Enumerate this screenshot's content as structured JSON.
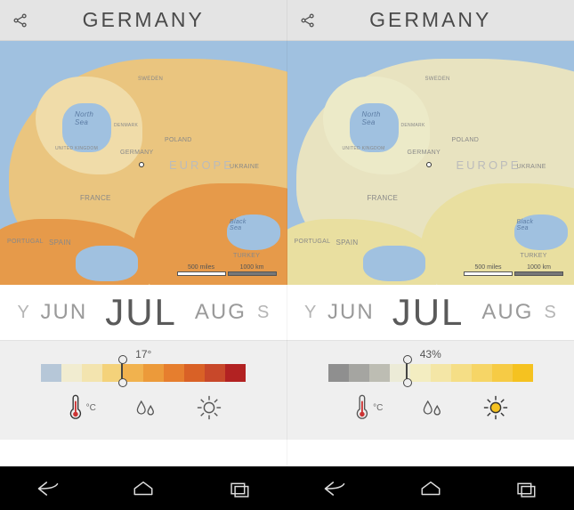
{
  "panes": [
    {
      "header": {
        "title": "GERMANY"
      },
      "map": {
        "labels": {
          "north_sea": "North\nSea",
          "europe": "EUROPE",
          "france": "FRANCE",
          "spain": "SPAIN",
          "portugal": "PORTUGAL",
          "germany": "GERMANY",
          "poland": "POLAND",
          "ukraine": "UKRAINE",
          "turkey": "TURKEY",
          "black_sea": "Black\nSea",
          "uk": "UNITED KINGDOM",
          "denmark": "DENMARK",
          "sweden": "SWEDEN"
        },
        "scale": {
          "left": "500 miles",
          "right": "1000 km"
        }
      },
      "months": {
        "prev2": "Y",
        "prev": "JUN",
        "current": "JUL",
        "next": "AUG",
        "next2": "S"
      },
      "metric": {
        "reading": "17°",
        "pointer_pct": 39,
        "colors": [
          "#b6c7d8",
          "#f1ecd0",
          "#f3e4af",
          "#f4d27a",
          "#f1b24e",
          "#ec9a3a",
          "#e67e2e",
          "#d96126",
          "#c8482a",
          "#b22222"
        ],
        "modes": {
          "temp_unit": "°C",
          "active": "temp"
        }
      }
    },
    {
      "header": {
        "title": "GERMANY"
      },
      "map": {
        "labels": {
          "north_sea": "North\nSea",
          "europe": "EUROPE",
          "france": "FRANCE",
          "spain": "SPAIN",
          "portugal": "PORTUGAL",
          "germany": "GERMANY",
          "poland": "POLAND",
          "ukraine": "UKRAINE",
          "turkey": "TURKEY",
          "black_sea": "Black\nSea",
          "uk": "UNITED KINGDOM",
          "denmark": "DENMARK",
          "sweden": "SWEDEN"
        },
        "scale": {
          "left": "500 miles",
          "right": "1000 km"
        }
      },
      "months": {
        "prev2": "Y",
        "prev": "JUN",
        "current": "JUL",
        "next": "AUG",
        "next2": "S"
      },
      "metric": {
        "reading": "43%",
        "pointer_pct": 38,
        "colors": [
          "#8f8f8f",
          "#a5a5a1",
          "#bdbdb3",
          "#ecebd7",
          "#f3edc1",
          "#f4e6a6",
          "#f5de86",
          "#f6d566",
          "#f6cb45",
          "#f5c220"
        ],
        "modes": {
          "temp_unit": "°C",
          "active": "sun"
        }
      }
    }
  ]
}
